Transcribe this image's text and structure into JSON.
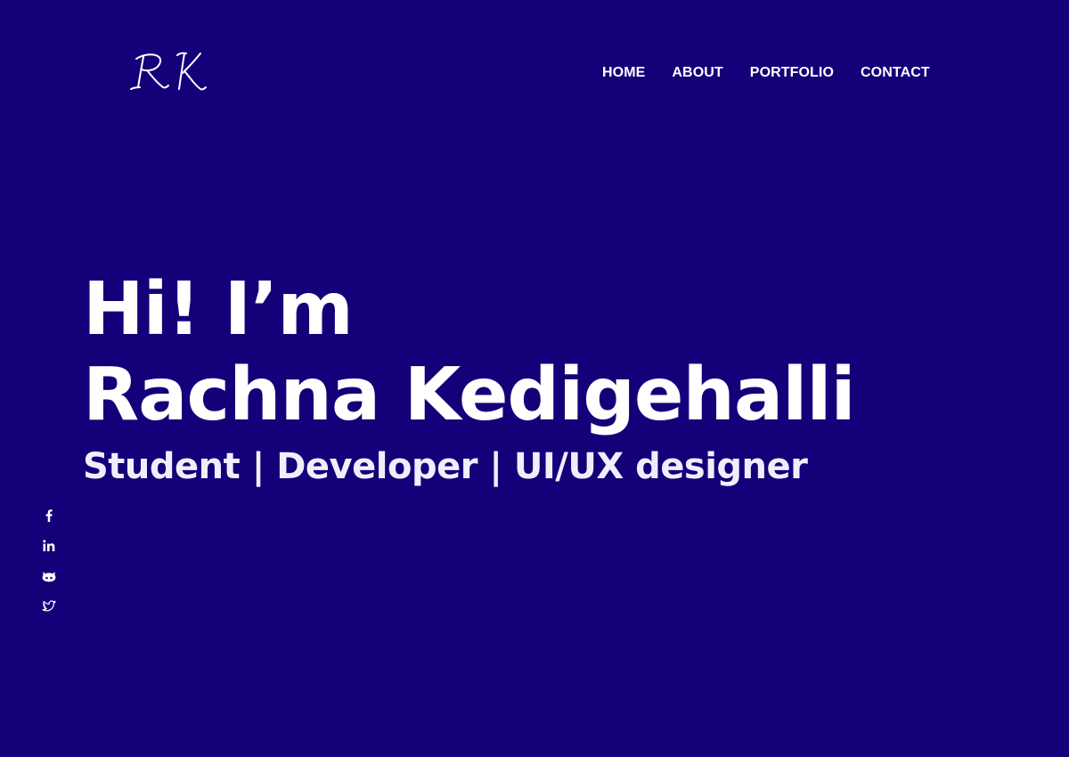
{
  "header": {
    "logo_text": "RK",
    "nav": [
      {
        "label": "HOME"
      },
      {
        "label": "ABOUT"
      },
      {
        "label": "PORTFOLIO"
      },
      {
        "label": "CONTACT"
      }
    ]
  },
  "hero": {
    "greeting": "Hi! I’m",
    "name": "Rachna Kedigehalli",
    "tagline": "Student | Developer | UI/UX designer"
  },
  "social": [
    {
      "icon": "facebook-icon"
    },
    {
      "icon": "linkedin-icon"
    },
    {
      "icon": "github-icon"
    },
    {
      "icon": "twitter-icon"
    }
  ],
  "colors": {
    "background": "#140078",
    "text": "#ffffff"
  }
}
